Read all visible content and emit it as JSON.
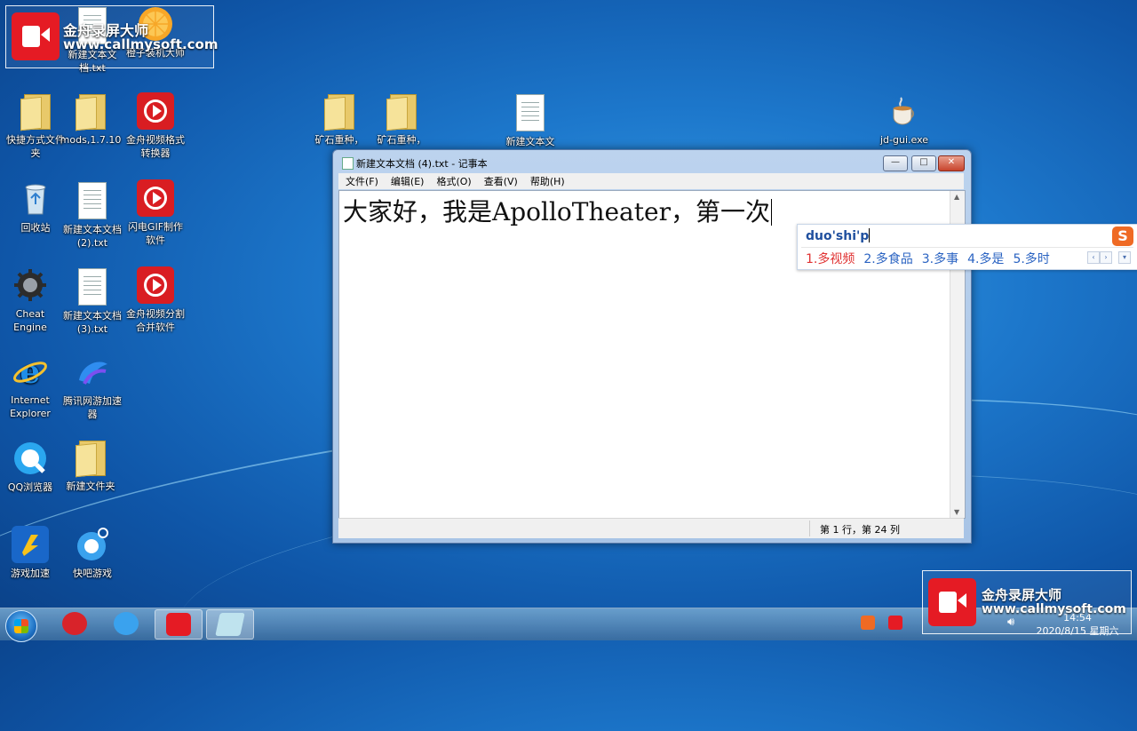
{
  "watermark": {
    "brand": "金舟录屏大师",
    "url": "www.callmysoft.com"
  },
  "desktop": {
    "icons": [
      {
        "id": "new-text-doc",
        "label": "新建文本文档.txt"
      },
      {
        "id": "orange-installer",
        "label": "橙子装机大师"
      },
      {
        "id": "shortcut-folder",
        "label": "快捷方式文件夹"
      },
      {
        "id": "mods",
        "label": "mods,1.7.10"
      },
      {
        "id": "video-converter",
        "label": "金舟视频格式转换器"
      },
      {
        "id": "recycle-bin",
        "label": "回收站"
      },
      {
        "id": "new-text-doc-2",
        "label": "新建文本文档 (2).txt"
      },
      {
        "id": "gif-maker",
        "label": "闪电GIF制作软件"
      },
      {
        "id": "cheat-engine",
        "label": "Cheat Engine"
      },
      {
        "id": "new-text-doc-3",
        "label": "新建文本文档 (3).txt"
      },
      {
        "id": "video-splitter",
        "label": "金舟视频分割合并软件"
      },
      {
        "id": "internet-explorer",
        "label": "Internet Explorer"
      },
      {
        "id": "tencent-accel",
        "label": "腾讯网游加速器"
      },
      {
        "id": "qq-browser",
        "label": "QQ浏览器"
      },
      {
        "id": "new-folder",
        "label": "新建文件夹"
      },
      {
        "id": "game-accel",
        "label": "游戏加速"
      },
      {
        "id": "kuaiba-games",
        "label": "快吧游戏"
      },
      {
        "id": "ore-seed-1",
        "label": "矿石重种，"
      },
      {
        "id": "ore-seed-2",
        "label": "矿石重种，"
      },
      {
        "id": "new-text-doc-top",
        "label": "新建文本文"
      },
      {
        "id": "jd-gui",
        "label": "jd-gui.exe"
      }
    ]
  },
  "notepad": {
    "title": "新建文本文档 (4).txt - 记事本",
    "menu": [
      "文件(F)",
      "编辑(E)",
      "格式(O)",
      "查看(V)",
      "帮助(H)"
    ],
    "content": "大家好，我是ApolloTheater，第一次",
    "status": "第 1 行，第 24 列",
    "btn_min": "—",
    "btn_max": "□",
    "btn_close": "✕"
  },
  "ime": {
    "composition": "duo'shi'p",
    "logo": "S",
    "candidates": [
      "1.多视频",
      "2.多食品",
      "3.多事",
      "4.多是",
      "5.多时"
    ],
    "prev": "‹",
    "next": "›",
    "more": "▾"
  },
  "taskbar": {
    "time": "14:54",
    "date": "2020/8/15 星期六"
  },
  "colors": {
    "accent_red": "#d91d22",
    "ime_selected": "#e03232",
    "ime_candidate": "#2a63c2"
  }
}
